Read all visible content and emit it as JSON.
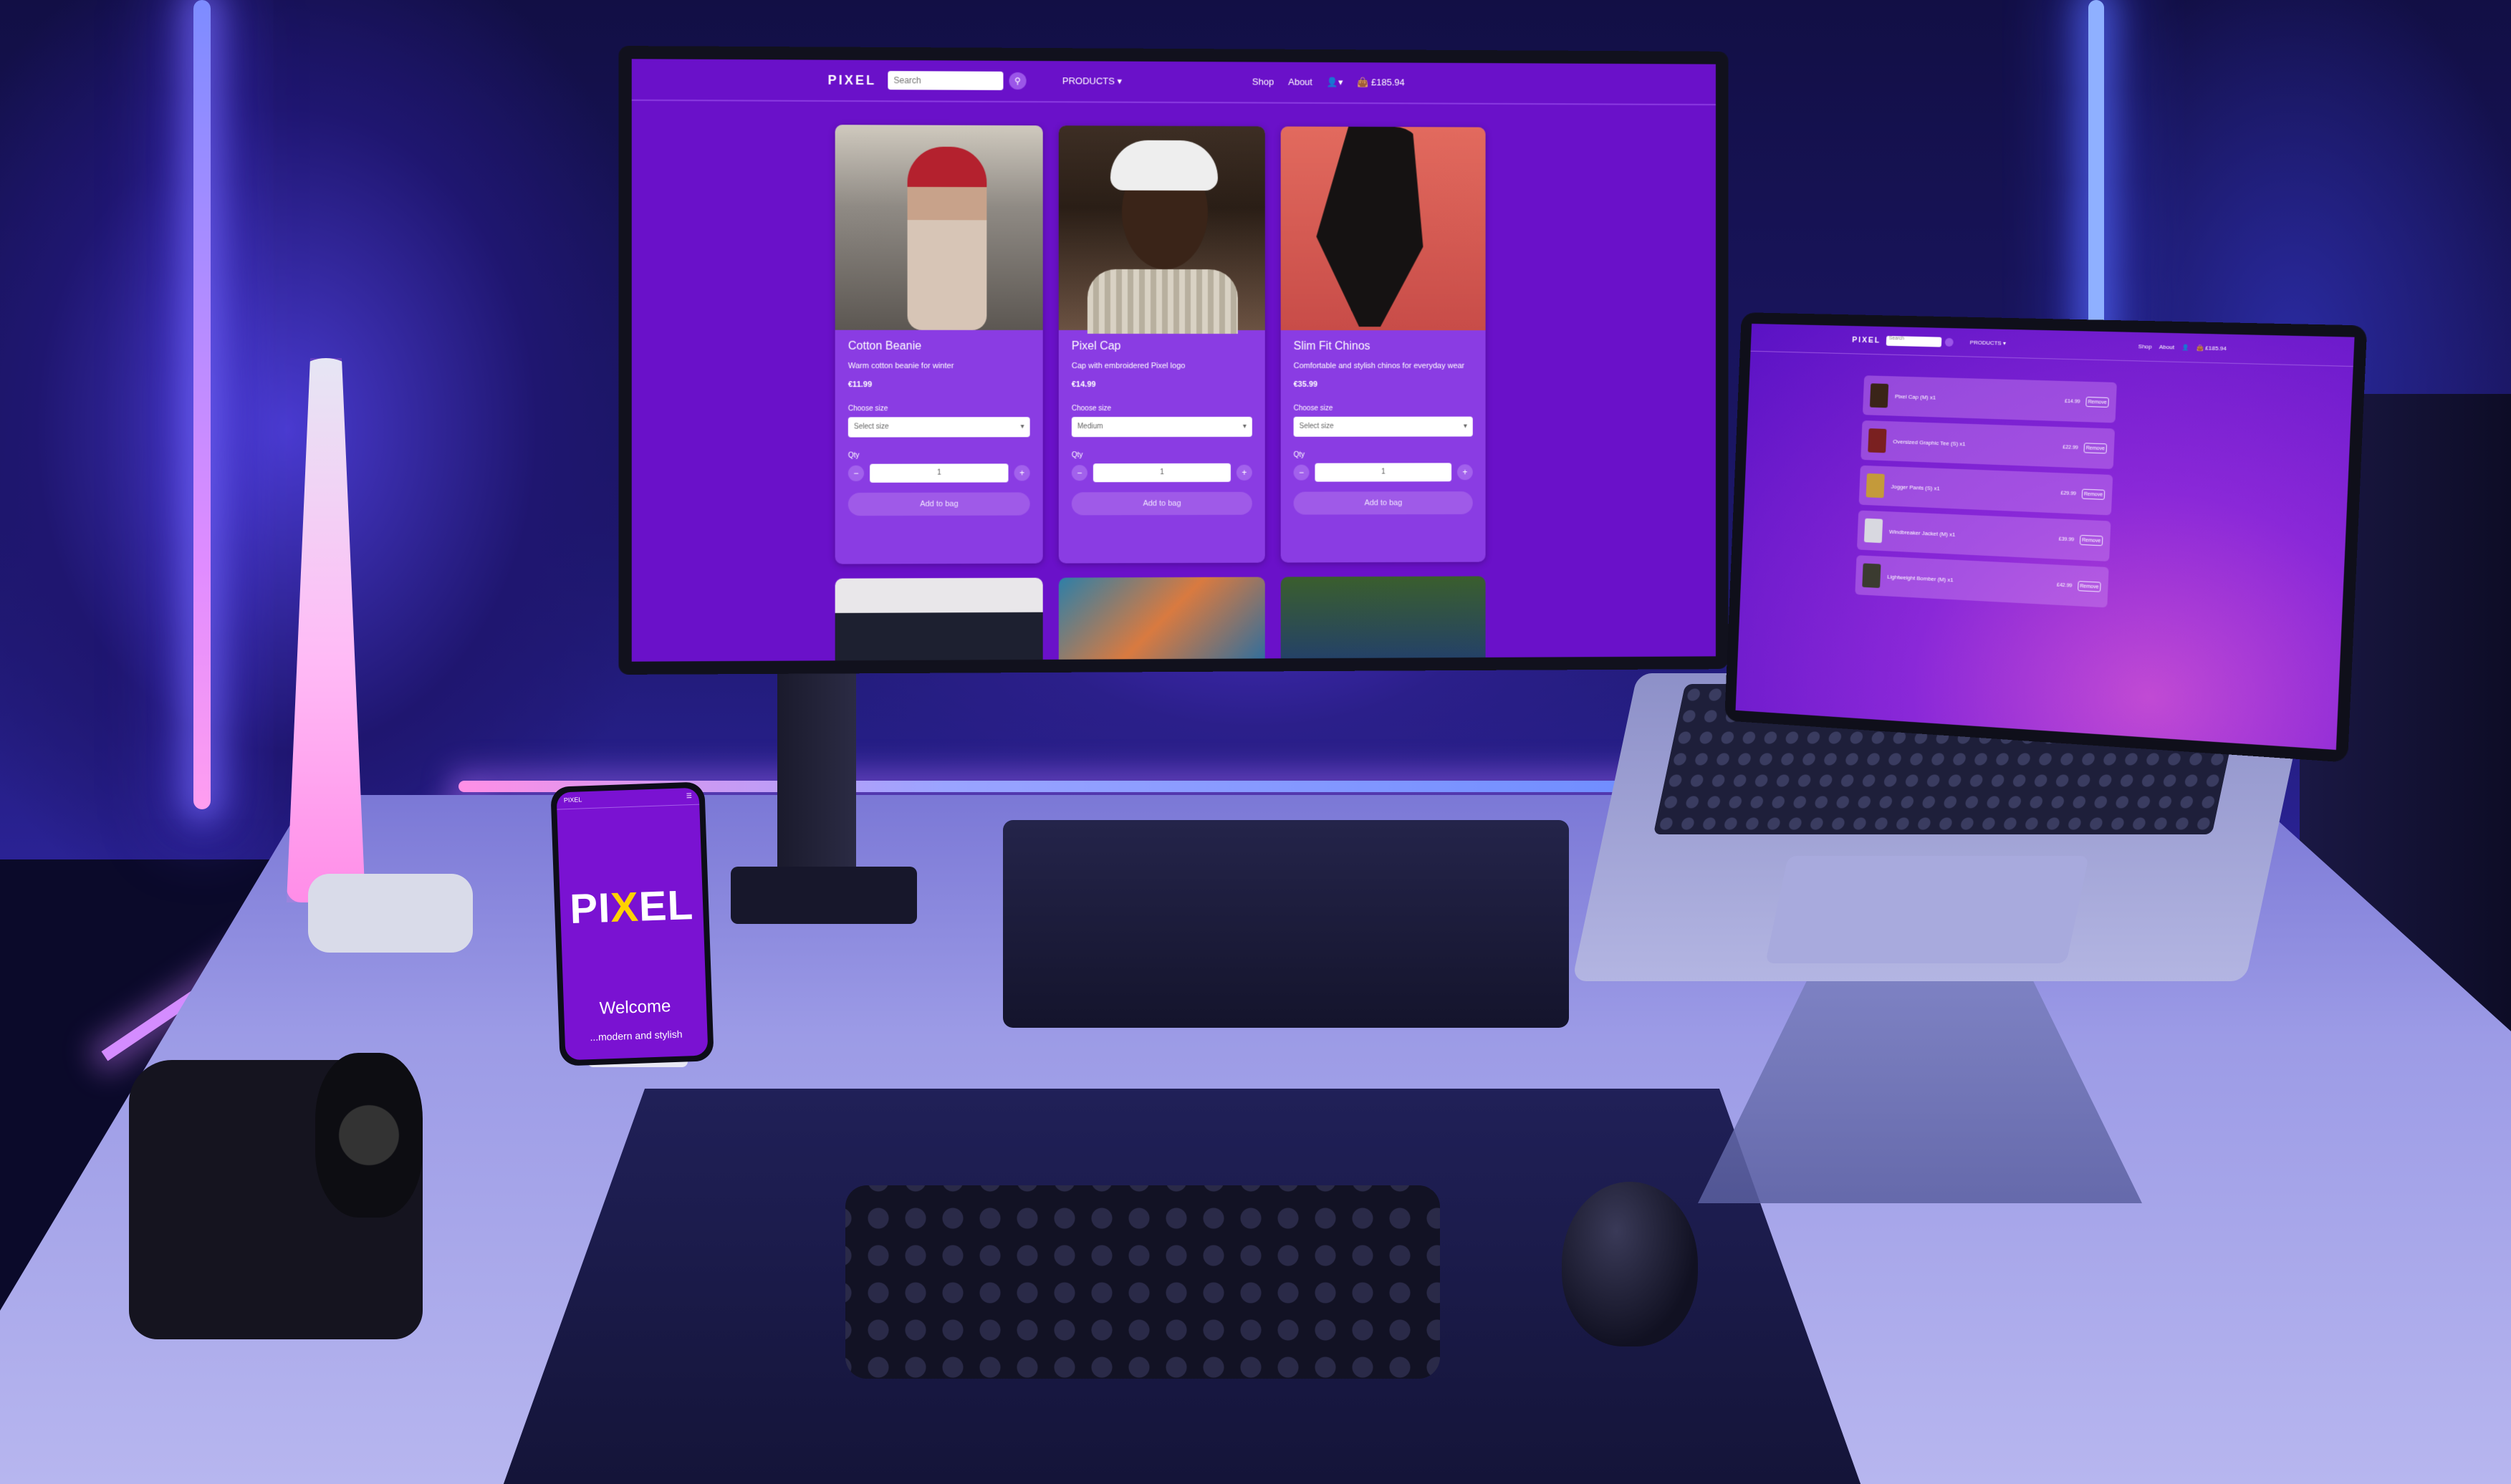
{
  "monitor": {
    "nav": {
      "brand": "PIXEL",
      "search_placeholder": "Search",
      "products_label": "PRODUCTS",
      "links": [
        "Shop",
        "About"
      ],
      "bag_total": "£185.94"
    },
    "products": [
      {
        "title": "Cotton Beanie",
        "description": "Warm cotton beanie for winter",
        "price": "€11.99",
        "size_label": "Choose size",
        "size_value": "Select size",
        "qty_label": "Qty",
        "qty_value": "1",
        "button": "Add to bag"
      },
      {
        "title": "Pixel Cap",
        "description": "Cap with embroidered Pixel logo",
        "price": "€14.99",
        "size_label": "Choose size",
        "size_value": "Medium",
        "qty_label": "Qty",
        "qty_value": "1",
        "button": "Add to bag"
      },
      {
        "title": "Slim Fit Chinos",
        "description": "Comfortable and stylish chinos for everyday wear",
        "price": "€35.99",
        "size_label": "Choose size",
        "size_value": "Select size",
        "qty_label": "Qty",
        "qty_value": "1",
        "button": "Add to bag"
      }
    ]
  },
  "laptop": {
    "nav": {
      "brand": "PIXEL",
      "search_placeholder": "Search",
      "products_label": "PRODUCTS",
      "links": [
        "Shop",
        "About"
      ],
      "bag_total": "£185.94"
    },
    "bag_items": [
      {
        "name": "Pixel Cap (M) x1",
        "price": "£14.99",
        "remove": "Remove",
        "thumb_color": "#3a2418"
      },
      {
        "name": "Oversized Graphic Tee (S) x1",
        "price": "£22.99",
        "remove": "Remove",
        "thumb_color": "#7a2020"
      },
      {
        "name": "Jogger Pants (S) x1",
        "price": "£29.99",
        "remove": "Remove",
        "thumb_color": "#c49a3a"
      },
      {
        "name": "Windbreaker Jacket (M) x1",
        "price": "£39.99",
        "remove": "Remove",
        "thumb_color": "#d8d8e0"
      },
      {
        "name": "Lightweight Bomber (M) x1",
        "price": "£42.99",
        "remove": "Remove",
        "thumb_color": "#3b3b30"
      }
    ]
  },
  "phone": {
    "nav_brand": "PIXEL",
    "logo_left": "PI",
    "logo_x": "X",
    "logo_right": "EL",
    "welcome": "Welcome",
    "subtitle": "...modern and stylish"
  },
  "colors": {
    "site_purple": "#6a11c9",
    "card_purple": "#8a3ce3",
    "logo_accent": "#ffd200"
  }
}
